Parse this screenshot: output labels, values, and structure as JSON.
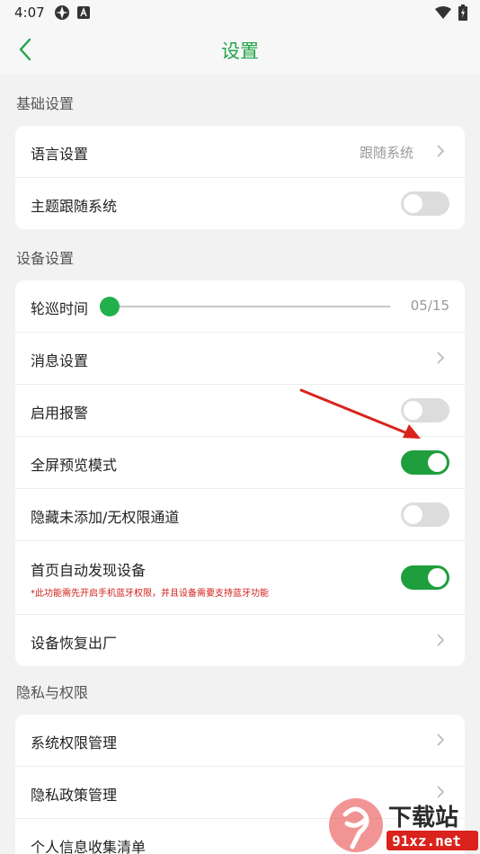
{
  "status": {
    "time": "4:07"
  },
  "header": {
    "title": "设置"
  },
  "sections": {
    "basic": {
      "label": "基础设置",
      "language": {
        "label": "语言设置",
        "value": "跟随系统"
      },
      "theme": {
        "label": "主题跟随系统",
        "on": false
      }
    },
    "device": {
      "label": "设备设置",
      "patrol": {
        "label": "轮巡时间",
        "value": "05/15"
      },
      "message": {
        "label": "消息设置"
      },
      "alarm": {
        "label": "启用报警",
        "on": false
      },
      "fullscreen": {
        "label": "全屏预览模式",
        "on": true
      },
      "hide": {
        "label": "隐藏未添加/无权限通道",
        "on": false
      },
      "discover": {
        "label": "首页自动发现设备",
        "note": "*此功能需先开启手机蓝牙权限，并且设备需要支持蓝牙功能",
        "on": true
      },
      "reset": {
        "label": "设备恢复出厂"
      }
    },
    "privacy": {
      "label": "隐私与权限",
      "permissions": {
        "label": "系统权限管理"
      },
      "policy": {
        "label": "隐私政策管理"
      },
      "collect": {
        "label": "个人信息收集清单"
      }
    }
  },
  "watermark": {
    "text_top": "下载站",
    "text_bottom": "91xz.net"
  },
  "colors": {
    "accent": "#22a447",
    "toggle_on": "#1f9e3d",
    "arrow": "#d9231c"
  }
}
